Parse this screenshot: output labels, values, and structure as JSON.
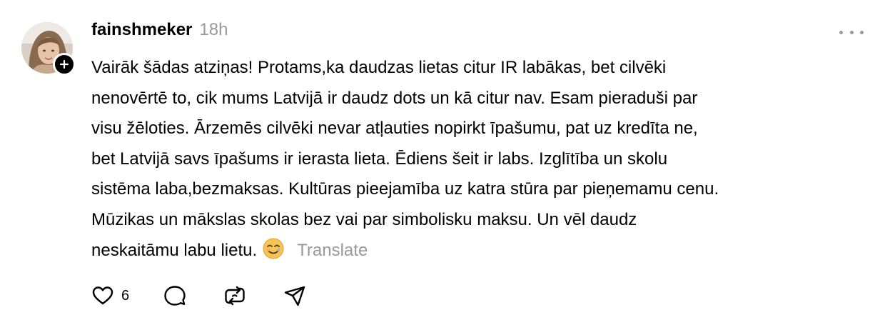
{
  "post": {
    "username": "fainshmeker",
    "timestamp": "18h",
    "body_lines": [
      "Vairāk šādas atziņas! Protams,ka daudzas lietas citur IR labākas, bet cilvēki",
      "nenovērtē to, cik mums Latvijā ir daudz dots un kā citur nav. Esam pieraduši par",
      "visu žēloties. Ārzemēs cilvēki nevar atļauties nopirkt īpašumu, pat uz kredīta ne,",
      "bet Latvijā savs īpašums ir ierasta lieta. Ēdiens šeit ir labs. Izglītība un skolu",
      "sistēma laba,bezmaksas. Kultūras pieejamība uz katra stūra par pieņemamu cenu.",
      "Mūzikas un mākslas skolas bez vai par simbolisku maksu. Un vēl daudz",
      "neskaitāmu labu lietu."
    ],
    "emoji_icon": "smiling-face-with-tear-icon",
    "translate_label": "Translate"
  },
  "actions": {
    "like_count": "6",
    "icons": [
      "heart-icon",
      "comment-icon",
      "repost-icon",
      "share-icon"
    ]
  },
  "colors": {
    "text": "#000000",
    "muted": "#999999",
    "background": "#ffffff"
  }
}
